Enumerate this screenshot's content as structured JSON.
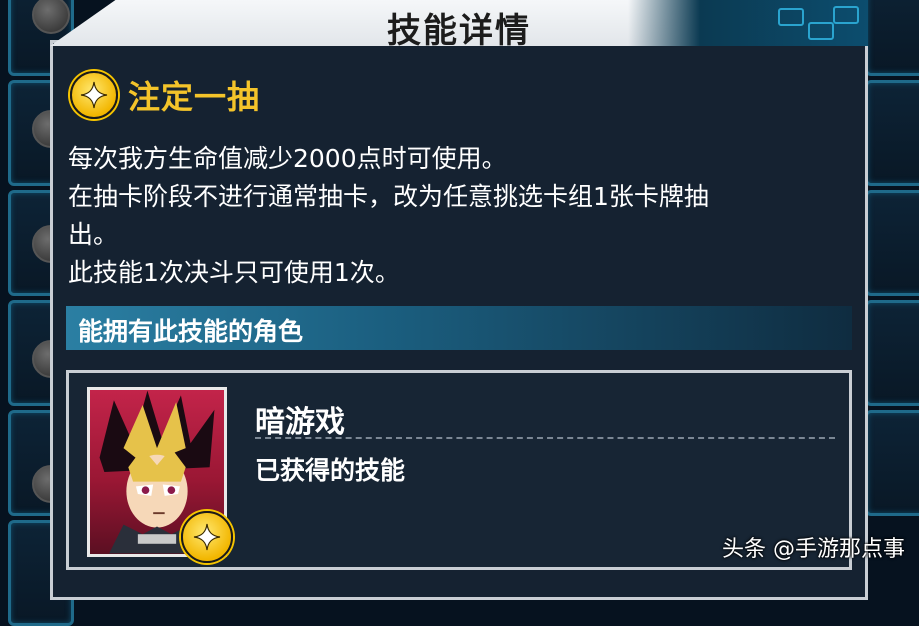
{
  "dialog": {
    "title": "技能详情",
    "skill_name": "注定一抽",
    "skill_icon": "sparkle-icon",
    "description_lines": [
      "每次我方生命值减少2000点时可使用。",
      "在抽卡阶段不进行通常抽卡，改为任意挑选卡组1张卡牌抽",
      "出。",
      "此技能1次决斗只可使用1次。"
    ],
    "owners_header": "能拥有此技能的角色",
    "character": {
      "name": "暗游戏",
      "status": "已获得的技能",
      "portrait": "character-portrait"
    }
  },
  "watermark": "头条 @手游那点事",
  "colors": {
    "accent_gold": "#f4c42a",
    "panel_bg": "#152231",
    "header_blue": "#2b7fa3"
  }
}
